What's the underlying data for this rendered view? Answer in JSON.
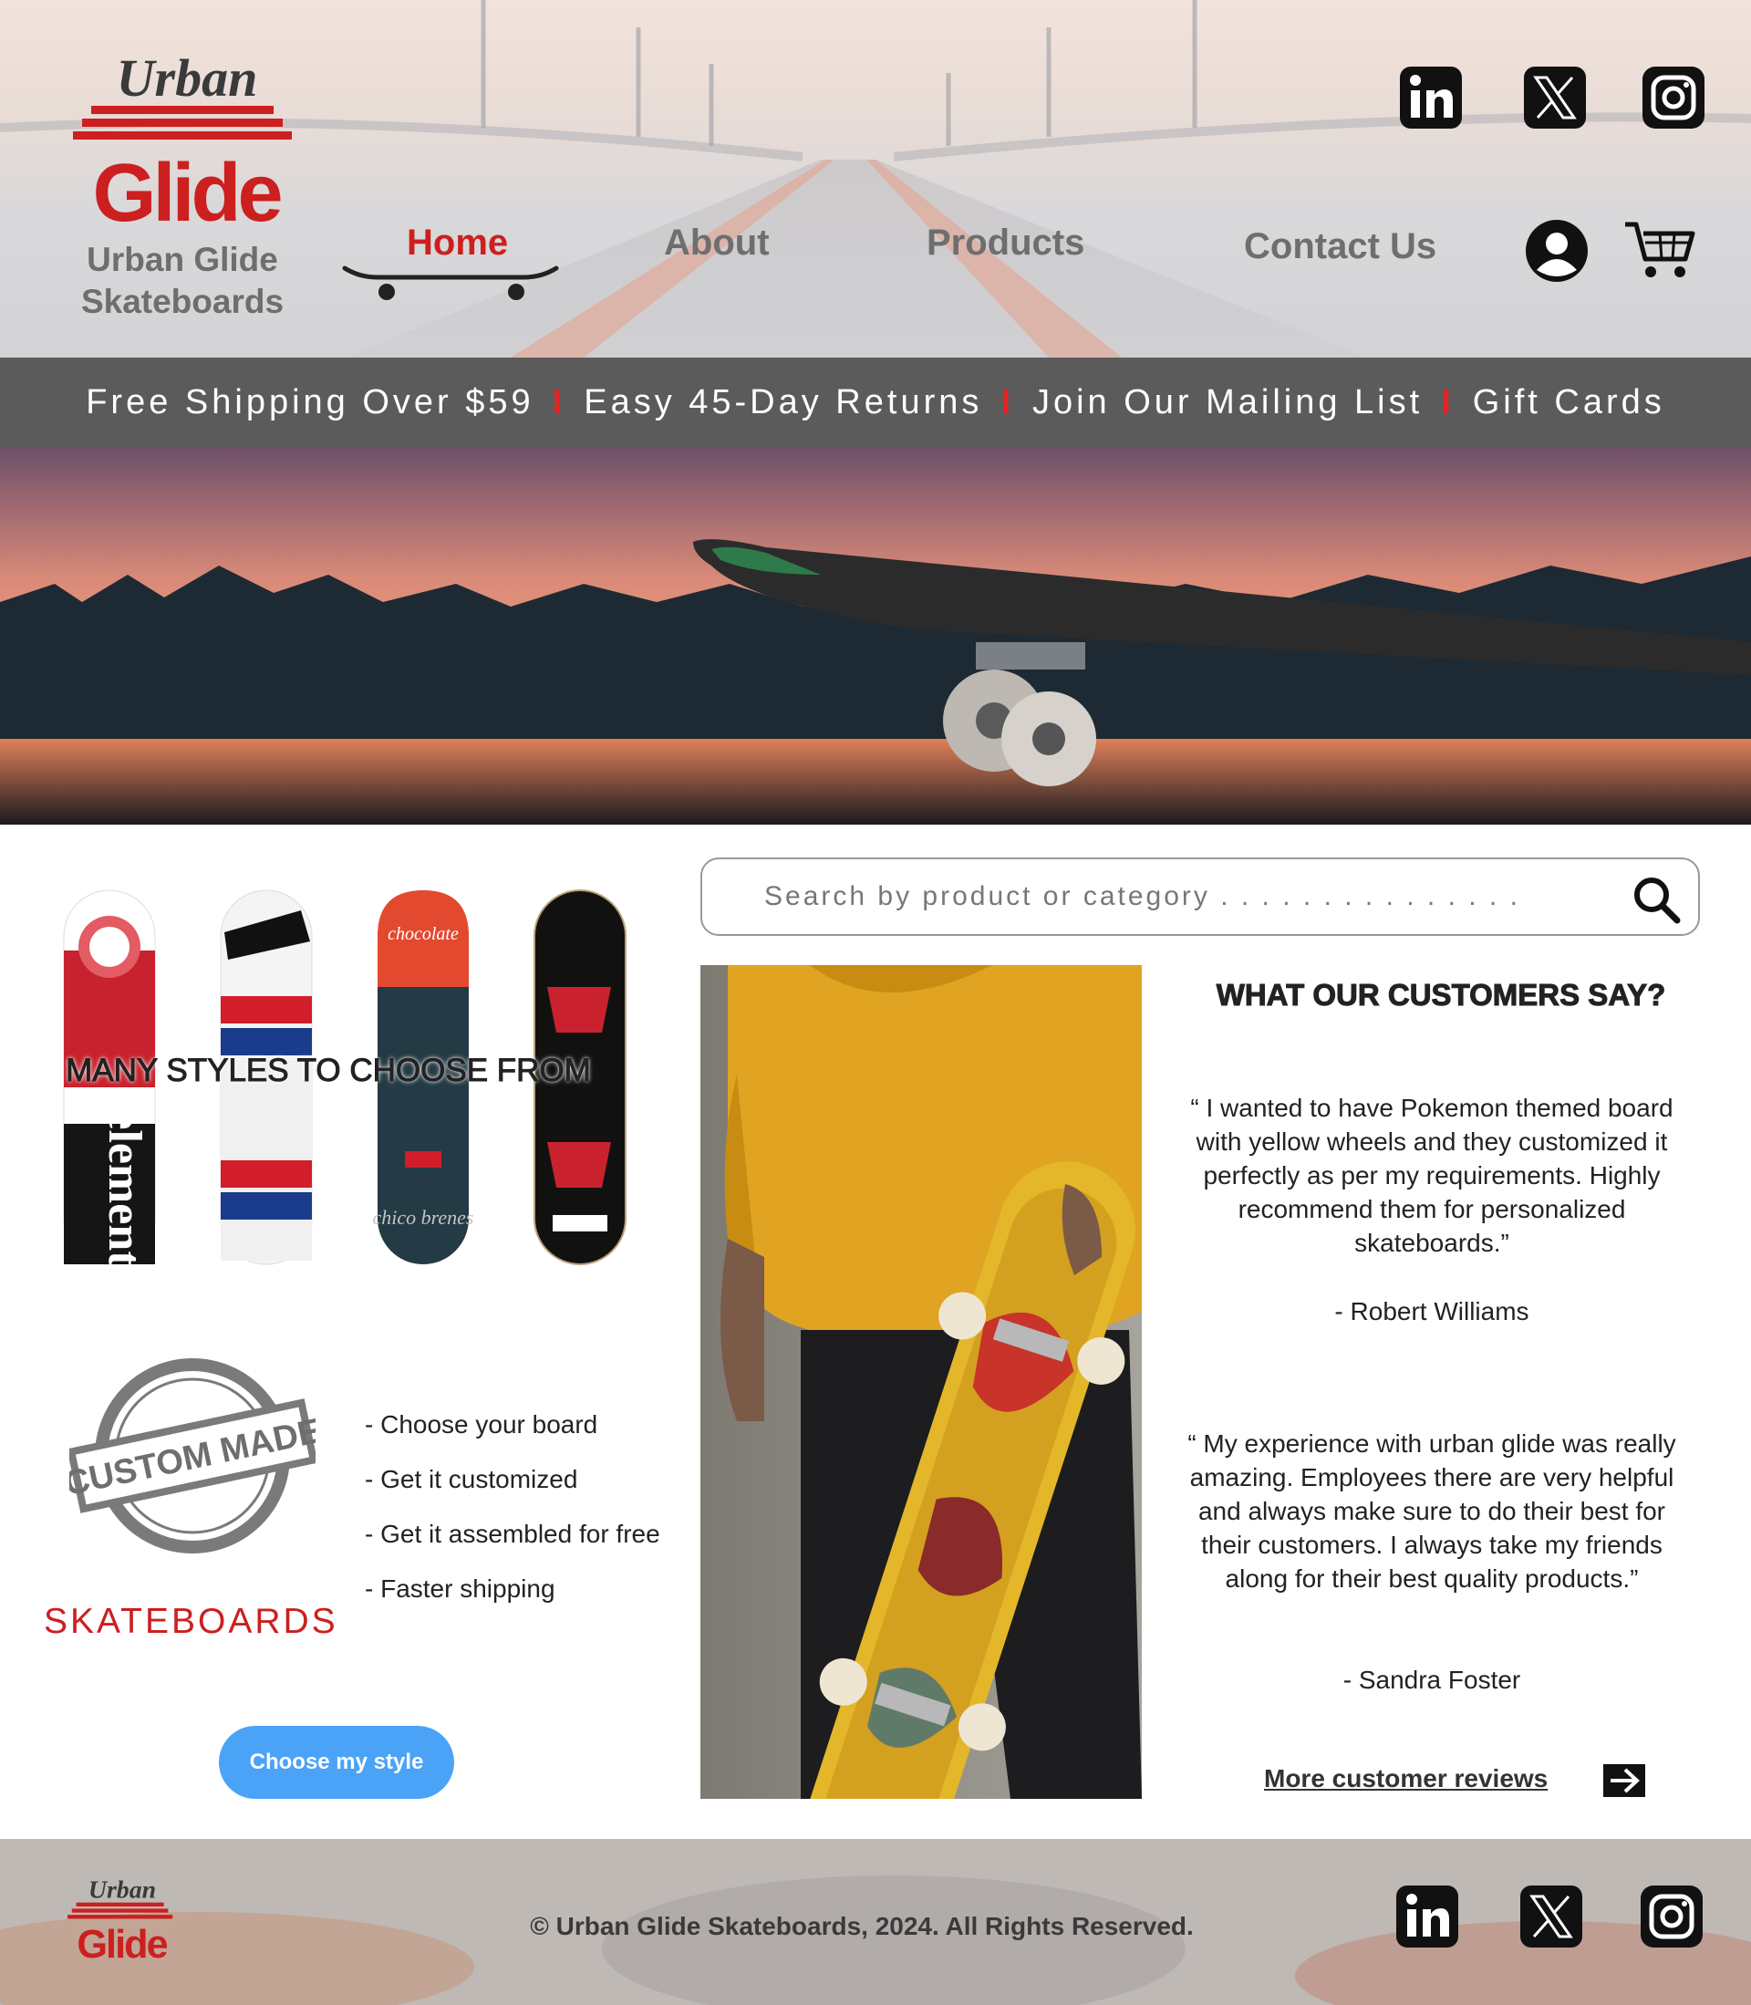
{
  "brand": {
    "logo_top": "Urban",
    "logo_bottom": "Glide",
    "name": "Urban Glide Skateboards"
  },
  "nav": {
    "items": [
      {
        "label": "Home",
        "active": true
      },
      {
        "label": "About",
        "active": false
      },
      {
        "label": "Products",
        "active": false
      },
      {
        "label": "Contact Us",
        "active": false
      }
    ]
  },
  "social": [
    "linkedin-icon",
    "x-icon",
    "instagram-icon"
  ],
  "header_icons": [
    "user-account-icon",
    "shopping-cart-icon"
  ],
  "promo": {
    "items": [
      "Free Shipping Over $59",
      "Easy 45-Day Returns",
      "Join Our Mailing List",
      "Gift Cards"
    ],
    "separator": "I"
  },
  "styles": {
    "heading": "MANY STYLES TO CHOOSE FROM",
    "deck_texts": [
      "element",
      "chocolate",
      "chico brenes"
    ]
  },
  "custom": {
    "stamp_text": "CUSTOM MADE",
    "title": "SKATEBOARDS",
    "features": [
      "- Choose your board",
      "- Get it customized",
      "- Get it assembled for free",
      "- Faster shipping"
    ],
    "button": "Choose my style"
  },
  "search": {
    "placeholder": "Search by product or category . . . . . . . . . . . . . . ."
  },
  "reviews": {
    "title": "WHAT OUR CUSTOMERS SAY?",
    "items": [
      {
        "text": "“ I wanted to have Pokemon themed board with yellow wheels and they customized it perfectly as per my requirements. Highly recommend them for personalized skateboards.”",
        "author": "-   Robert Williams"
      },
      {
        "text": "“ My experience with urban glide was really amazing. Employees there are very helpful and always make sure to do their best for their customers. I always take my friends along for their best quality products.”",
        "author": "-   Sandra Foster"
      }
    ],
    "more_link": "More customer reviews"
  },
  "footer": {
    "copyright": "© Urban Glide Skateboards, 2024. All Rights Reserved."
  },
  "colors": {
    "accent_red": "#cc1f1f",
    "nav_gray": "#6e6e6e",
    "promo_bg": "#5b5b5b",
    "button_blue": "#4aa3f6"
  }
}
